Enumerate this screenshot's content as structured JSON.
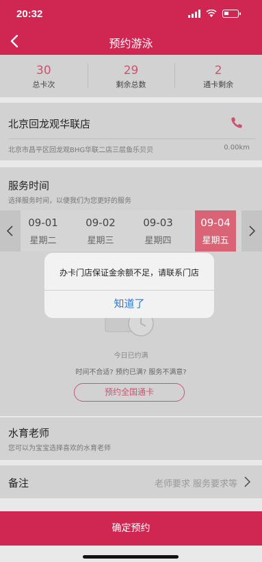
{
  "status_bar": {
    "time": "20:32"
  },
  "nav": {
    "title": "预约游泳"
  },
  "stats": [
    {
      "value": "30",
      "label": "总卡次"
    },
    {
      "value": "29",
      "label": "剩余总数"
    },
    {
      "value": "2",
      "label": "通卡剩余"
    }
  ],
  "store": {
    "name": "北京回龙观华联店",
    "address": "北京市昌平区回龙观BHG华联二店三层鱼乐贝贝",
    "distance": "0.00km"
  },
  "service": {
    "title": "服务时间",
    "subtitle": "选择服务时间，以便我们为您更好的服务",
    "days": [
      {
        "date": "09-01",
        "weekday": "星期二"
      },
      {
        "date": "09-02",
        "weekday": "星期三"
      },
      {
        "date": "09-03",
        "weekday": "星期四"
      },
      {
        "date": "09-04",
        "weekday": "星期五"
      }
    ],
    "full_text": "今日已约满",
    "hint_text": "时间不合适? 预约已满? 服务不满意?",
    "national_card_button": "预约全国通卡"
  },
  "teacher": {
    "title": "水育老师",
    "subtitle": "您可以为宝宝选择喜欢的水育老师"
  },
  "remark": {
    "title": "备注",
    "placeholder": "老师要求 服务要求等"
  },
  "submit_label": "确定预约",
  "alert": {
    "message": "办卡门店保证金余额不足，请联系门店",
    "confirm": "知道了"
  },
  "colors": {
    "brand": "#d02652",
    "accent_text": "#c9546f",
    "link": "#2b78d6"
  }
}
